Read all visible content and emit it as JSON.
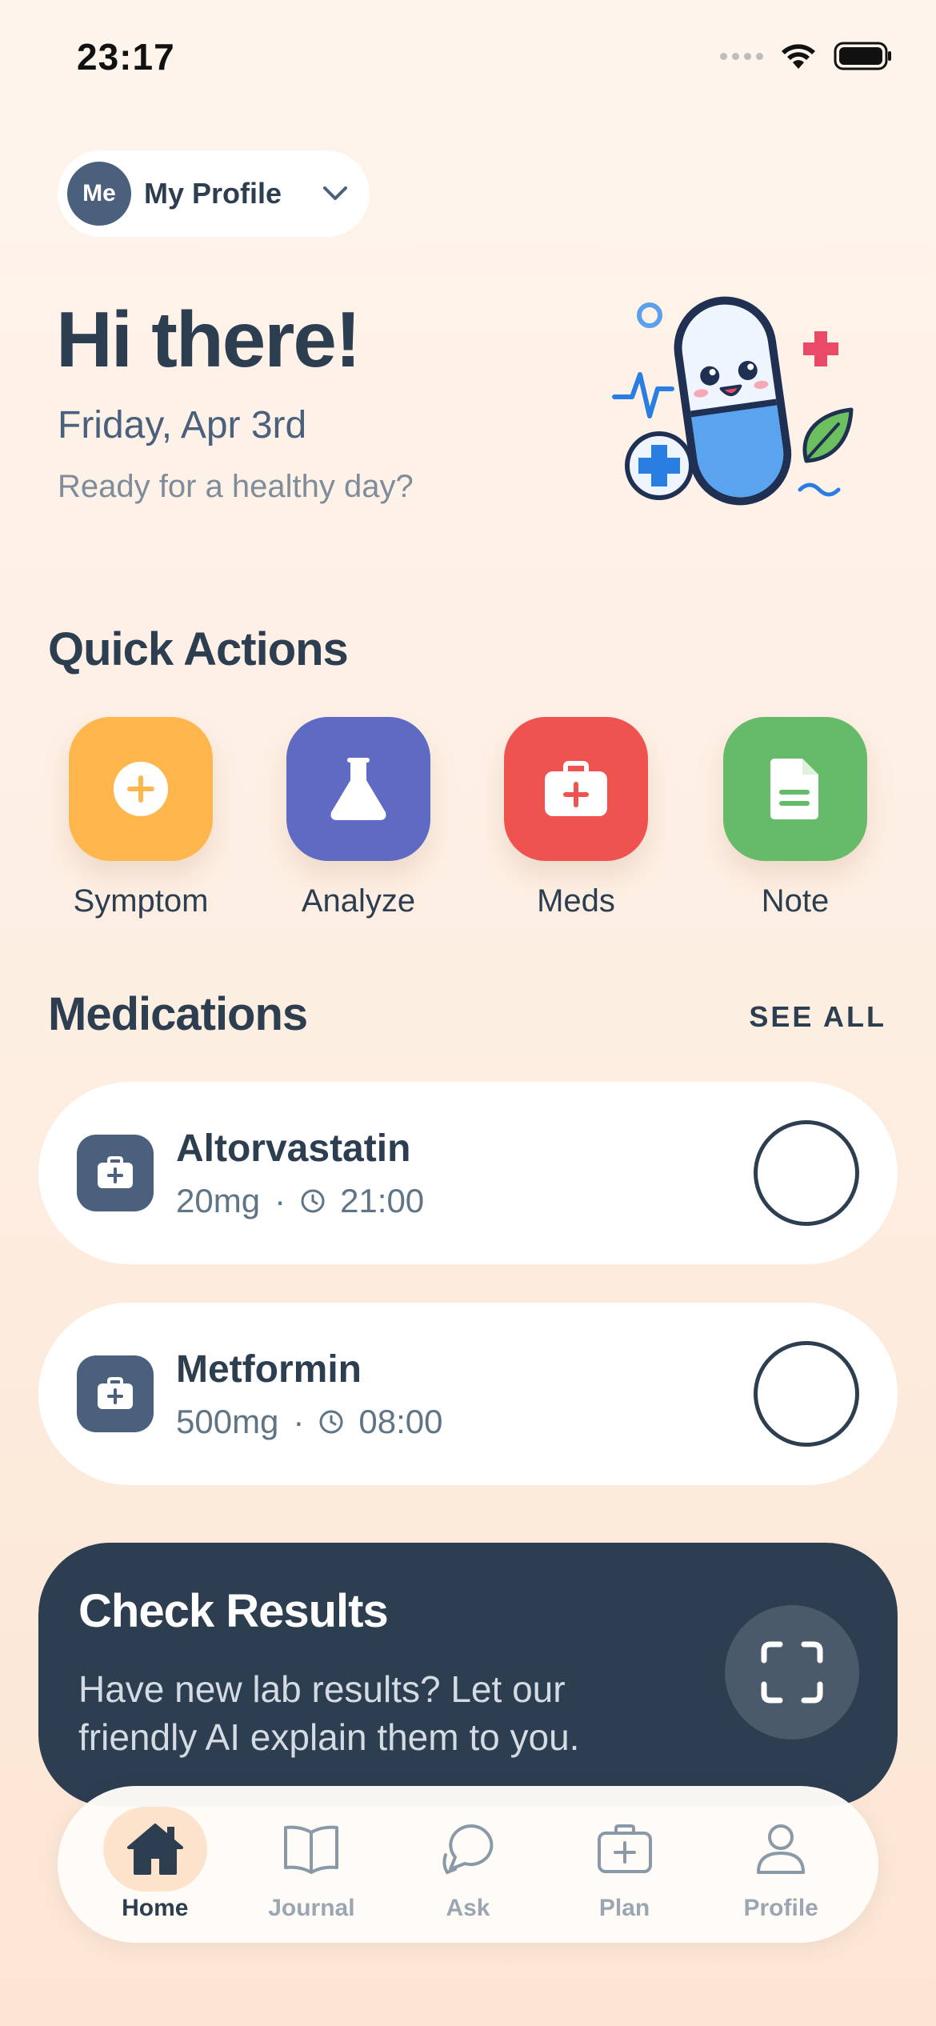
{
  "status_bar": {
    "time": "23:17"
  },
  "profile": {
    "initials": "Me",
    "name": "My Profile"
  },
  "greeting": {
    "title": "Hi there!",
    "date": "Friday, Apr 3rd",
    "tagline": "Ready for a healthy day?"
  },
  "quick_actions": {
    "title": "Quick Actions",
    "items": [
      {
        "label": "Symptom",
        "color": "#ffb64d",
        "icon": "plus-circle-icon"
      },
      {
        "label": "Analyze",
        "color": "#5f6bc2",
        "icon": "flask-icon"
      },
      {
        "label": "Meds",
        "color": "#ef5350",
        "icon": "medkit-icon"
      },
      {
        "label": "Note",
        "color": "#66bb6a",
        "icon": "document-icon"
      }
    ]
  },
  "medications": {
    "title": "Medications",
    "see_all": "SEE ALL",
    "items": [
      {
        "name": "Altorvastatin",
        "dose": "20mg",
        "time": "21:00",
        "taken": false
      },
      {
        "name": "Metformin",
        "dose": "500mg",
        "time": "08:00",
        "taken": false
      }
    ]
  },
  "check_results": {
    "title": "Check Results",
    "description": "Have new lab results? Let our friendly AI explain them to you."
  },
  "tabbar": {
    "active": "Home",
    "items": [
      {
        "label": "Home",
        "icon": "home-icon"
      },
      {
        "label": "Journal",
        "icon": "book-icon"
      },
      {
        "label": "Ask",
        "icon": "chat-icon"
      },
      {
        "label": "Plan",
        "icon": "medkit-icon"
      },
      {
        "label": "Profile",
        "icon": "user-icon"
      }
    ]
  }
}
